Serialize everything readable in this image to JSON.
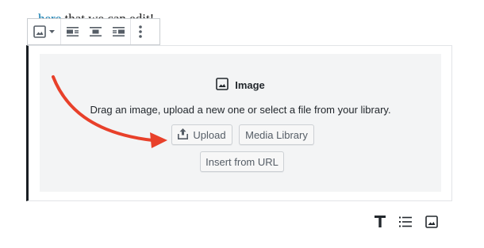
{
  "paragraph": {
    "before_link": "",
    "link_text": "here",
    "after_link": " that we can edit!"
  },
  "toolbar": {
    "items": [
      "image-icon",
      "chevron-down-icon",
      "align-left-icon",
      "align-center-icon",
      "align-right-icon",
      "more-options-icon"
    ]
  },
  "image_block": {
    "title": "Image",
    "instructions": "Drag an image, upload a new one or select a file from your library.",
    "upload_label": "Upload",
    "media_library_label": "Media Library",
    "insert_url_label": "Insert from URL"
  },
  "inserter": {
    "items": [
      "text-icon",
      "list-icon",
      "image-icon"
    ]
  },
  "colors": {
    "annotation_arrow": "#e8402a",
    "link": "#0073aa",
    "placeholder_bg": "#f3f4f5"
  }
}
